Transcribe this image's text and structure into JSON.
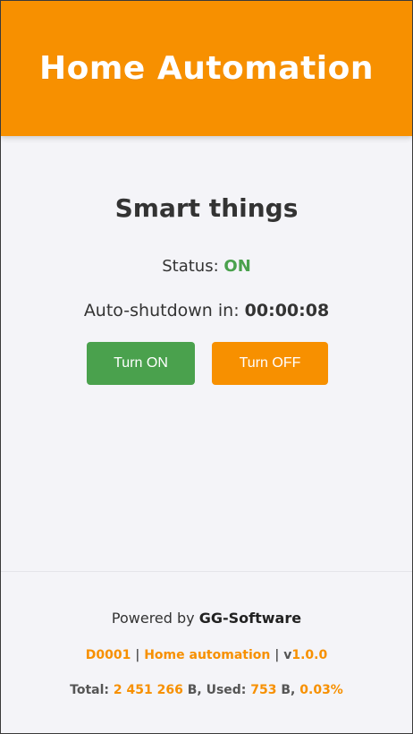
{
  "colors": {
    "accent": "#f79000",
    "success": "#4aa14d",
    "text": "#333333",
    "background": "#f4f4f8"
  },
  "header": {
    "title": "Home Automation"
  },
  "main": {
    "title": "Smart things",
    "status_label": "Status:",
    "status_value": "ON",
    "timer_label": "Auto-shutdown in:",
    "timer_value": "00:00:08",
    "turn_on_label": "Turn ON",
    "turn_off_label": "Turn OFF"
  },
  "footer": {
    "powered_by_label": "Powered by",
    "company": "GG-Software",
    "device_id": "D0001",
    "separator": "|",
    "app_name": "Home automation",
    "version_prefix": "v",
    "version": "1.0.0",
    "total_label": "Total:",
    "total_value": "2 451 266",
    "total_unit": "B,",
    "used_label": "Used:",
    "used_value": "753",
    "used_unit": "B,",
    "used_percent": "0.03%"
  }
}
